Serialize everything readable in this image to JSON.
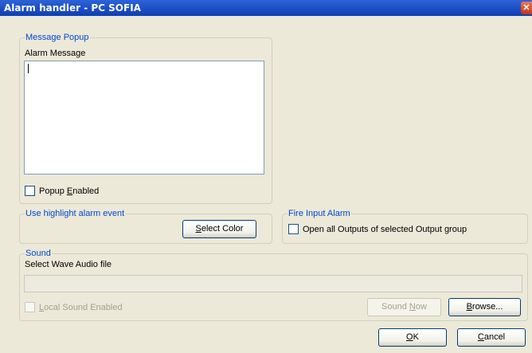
{
  "window": {
    "title": "Alarm handler - PC SOFIA",
    "close_glyph": "✕"
  },
  "message_popup": {
    "group_title": "Message Popup",
    "label": "Alarm Message",
    "message_value": "",
    "popup_enabled": {
      "pre": "Popup ",
      "key": "E",
      "post": "nabled",
      "checked": false
    }
  },
  "highlight": {
    "group_title": "Use highlight alarm event",
    "select_color": {
      "pre": "",
      "key": "S",
      "post": "elect Color"
    }
  },
  "fire_input": {
    "group_title": "Fire Input Alarm",
    "open_outputs": {
      "label": "Open all Outputs of selected Output group",
      "checked": false
    }
  },
  "sound": {
    "group_title": "Sound",
    "wave_label": "Select Wave Audio file",
    "wave_value": "",
    "local_sound": {
      "pre": "",
      "key": "L",
      "post": "ocal Sound Enabled",
      "checked": false,
      "enabled": false
    },
    "sound_now": {
      "pre": "Sound ",
      "key": "N",
      "post": "ow",
      "enabled": false
    },
    "browse": {
      "pre": "",
      "key": "B",
      "post": "rowse..."
    }
  },
  "footer": {
    "ok": {
      "pre": "",
      "key": "O",
      "post": "K"
    },
    "cancel": {
      "pre": "",
      "key": "C",
      "post": "ancel"
    }
  }
}
